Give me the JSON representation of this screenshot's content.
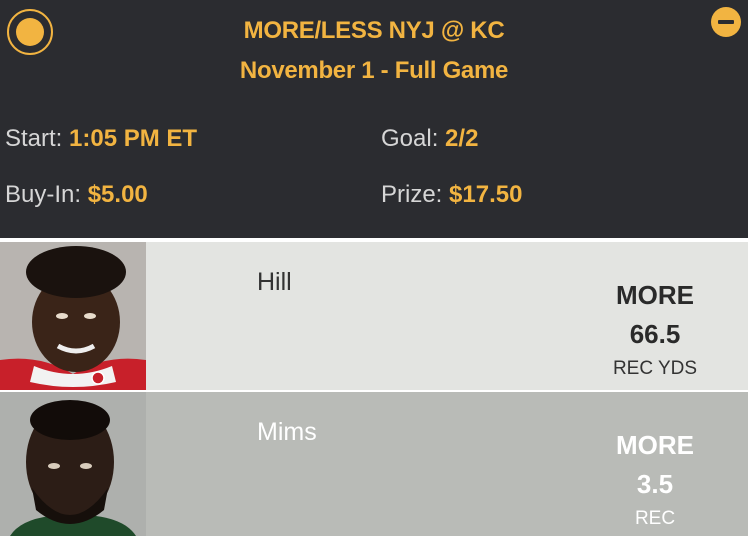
{
  "header": {
    "title": "MORE/LESS NYJ @ KC",
    "subtitle": "November 1 - Full Game",
    "start_label": "Start:",
    "start_value": "1:05 PM ET",
    "goal_label": "Goal:",
    "goal_value": "2/2",
    "buyin_label": "Buy-In:",
    "buyin_value": "$5.00",
    "prize_label": "Prize:",
    "prize_value": "$17.50",
    "icons": {
      "left": "radio-selected-icon",
      "right": "collapse-minus-icon"
    }
  },
  "picks": [
    {
      "name": "Hill",
      "direction": "MORE",
      "line": "66.5",
      "stat": "REC YDS"
    },
    {
      "name": "Mims",
      "direction": "MORE",
      "line": "3.5",
      "stat": "REC"
    }
  ],
  "colors": {
    "accent": "#f2b441",
    "header_bg": "#2b2c30",
    "row1_bg": "#e3e4e1",
    "row2_bg": "#b9bbb7"
  }
}
